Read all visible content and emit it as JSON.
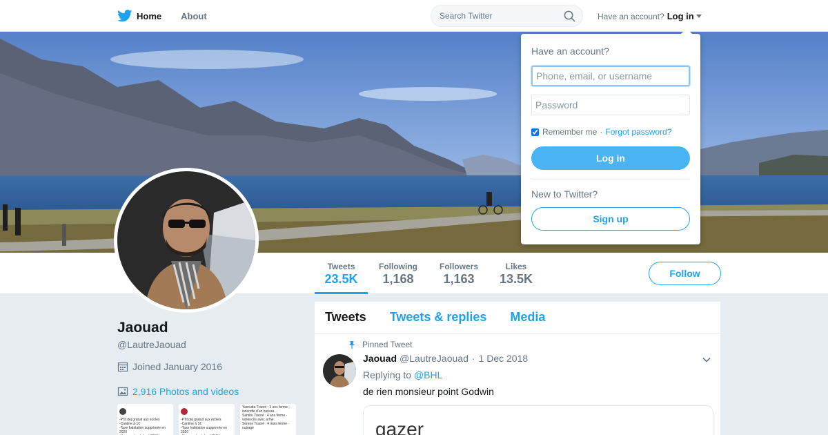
{
  "nav": {
    "home_label": "Home",
    "about_label": "About",
    "search_placeholder": "Search Twitter",
    "have_account": "Have an account?",
    "login_label": "Log in"
  },
  "profile_nav": {
    "stats": [
      {
        "label": "Tweets",
        "value": "23.5K"
      },
      {
        "label": "Following",
        "value": "1,168"
      },
      {
        "label": "Followers",
        "value": "1,163"
      },
      {
        "label": "Likes",
        "value": "13.5K"
      }
    ],
    "follow_label": "Follow"
  },
  "profile": {
    "name": "Jaouad",
    "handle": "@LautreJaouad",
    "joined": "Joined January 2016",
    "photos": "2,916 Photos and videos"
  },
  "thumbnails": [
    {
      "text": "-P'tit dej gratuit aux écoles\n-Cantine à 1€\n-Taxe habitation supprimée en 2020\n-Hausse du plafond CMU pour un bon nombre aux écoles"
    },
    {
      "text": "-P'tit dej gratuit aux écoles\n-Cantine à 1€\n-Taxe habitation supprimée en 2020\n-Hausse du plafond CMU pour un bon nombre"
    },
    {
      "text": "Yacouba Traoré : 3 ans ferme - incendie d'un bureau.\nSambo Traoré : 4 ans ferme - violences avec arme.\nSerene Traoré : 4 mois ferme - outrage"
    }
  ],
  "timeline": {
    "tabs": [
      "Tweets",
      "Tweets & replies",
      "Media"
    ],
    "pinned_label": "Pinned Tweet",
    "tweet": {
      "name": "Jaouad",
      "handle": "@LautreJaouad",
      "separator": "·",
      "date": "1 Dec 2018",
      "replying_to_label": "Replying to",
      "replying_to_handle": "@BHL",
      "text": "de rien monsieur point Godwin",
      "card_text": "gazer"
    }
  },
  "login_dropdown": {
    "title": "Have an account?",
    "username_placeholder": "Phone, email, or username",
    "password_placeholder": "Password",
    "remember_label": "Remember me",
    "separator": "·",
    "forgot_label": "Forgot password?",
    "login_button": "Log in",
    "new_label": "New to Twitter?",
    "signup_button": "Sign up"
  },
  "colors": {
    "accent": "#1da1f2",
    "login_button": "#4ab3f4",
    "background": "#e6ecf0"
  }
}
